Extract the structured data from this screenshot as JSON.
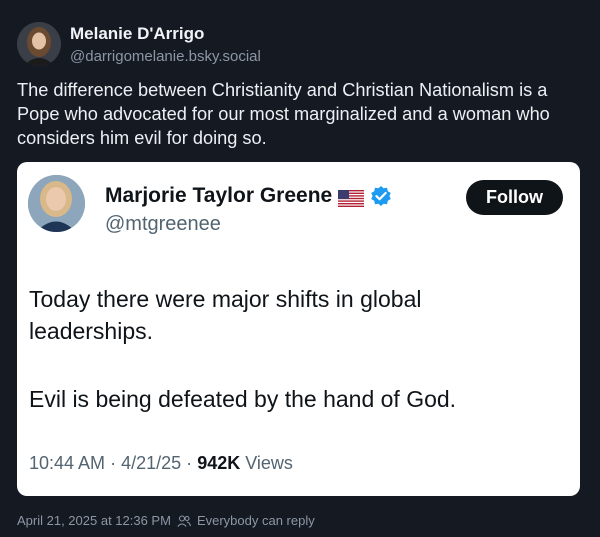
{
  "post": {
    "author_name": "Melanie D'Arrigo",
    "author_handle": "@darrigomelanie.bsky.social",
    "text": "The difference between Christianity and Christian Nationalism is a Pope who advocated for our most marginalized and a woman who considers him evil for doing so."
  },
  "embed": {
    "name": "Marjorie Taylor Greene",
    "handle": "@mtgreenee",
    "follow_label": "Follow",
    "text_line1": "Today there were major shifts in global leaderships.",
    "text_line2": "Evil is being defeated by the hand of God.",
    "time": "10:44 AM",
    "date": "4/21/25",
    "views_count": "942K",
    "views_label": "Views",
    "separator": "·"
  },
  "footer": {
    "timestamp": "April 21, 2025 at 12:36 PM",
    "reply_setting": "Everybody can reply"
  },
  "colors": {
    "background": "#151a22",
    "embed_bg": "#ffffff",
    "verified_blue": "#1d9bf0",
    "follow_bg": "#0f1419"
  },
  "icons": [
    "avatar",
    "us-flag-icon",
    "verified-badge-icon",
    "people-icon"
  ]
}
